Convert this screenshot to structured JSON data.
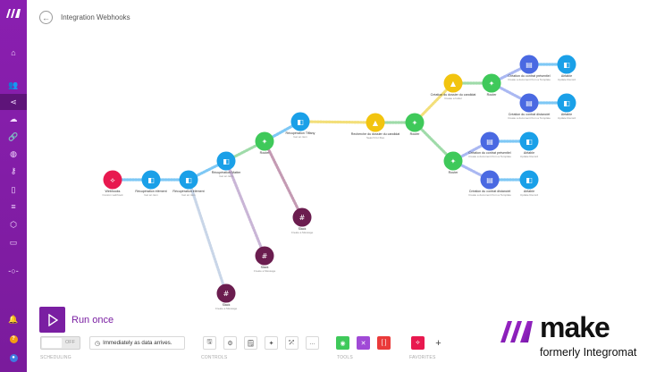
{
  "sidebar": {
    "logo": "make-logo",
    "items": [
      {
        "icon": "home-icon",
        "glyph": "⌂"
      },
      {
        "icon": "team-icon",
        "glyph": "👥"
      },
      {
        "icon": "share-scenarios-icon",
        "glyph": "⋖"
      },
      {
        "icon": "templates-icon",
        "glyph": "☁"
      },
      {
        "icon": "connections-icon",
        "glyph": "🔗"
      },
      {
        "icon": "webhooks-icon",
        "glyph": "◍"
      },
      {
        "icon": "keys-icon",
        "glyph": "⚷"
      },
      {
        "icon": "devices-icon",
        "glyph": "▯"
      },
      {
        "icon": "datastores-icon",
        "glyph": "≡"
      },
      {
        "icon": "datastructures-icon",
        "glyph": "⬡"
      },
      {
        "icon": "docs-icon",
        "glyph": "▭"
      },
      {
        "icon": "flow-icon",
        "glyph": "-○-"
      },
      {
        "icon": "notifications-icon",
        "glyph": "🔔"
      },
      {
        "icon": "help-icon",
        "glyph": "?"
      },
      {
        "icon": "avatar-icon",
        "glyph": "●"
      }
    ]
  },
  "header": {
    "title": "Integration Webhooks"
  },
  "canvas": {
    "nodes": [
      {
        "id": "webhooks",
        "label": "Webhooks",
        "sub": "Custom webhook",
        "color": "#e8194f",
        "icon": "webhook-icon"
      },
      {
        "id": "ax1",
        "label": "Récupération élément",
        "sub": "Get an item",
        "color": "#1aa0e8",
        "icon": "airtable-icon"
      },
      {
        "id": "ax2",
        "label": "Récupération élément",
        "sub": "Get an item",
        "color": "#1aa0e8",
        "icon": "airtable-icon"
      },
      {
        "id": "ax3",
        "label": "Récupération Matter",
        "sub": "Get an item",
        "color": "#1aa0e8",
        "icon": "airtable-icon"
      },
      {
        "id": "router1",
        "label": "Router",
        "sub": "",
        "color": "#3fc95a",
        "icon": "router-icon"
      },
      {
        "id": "ax4",
        "label": "Récupération Tiffany",
        "sub": "Get an item",
        "color": "#1aa0e8",
        "icon": "airtable-icon"
      },
      {
        "id": "gdrive1",
        "label": "Recherche du dossier du candidat",
        "sub": "Search for files",
        "color": "#f2c40f",
        "icon": "drive-icon"
      },
      {
        "id": "router2",
        "label": "Router",
        "sub": "",
        "color": "#3fc95a",
        "icon": "router-icon"
      },
      {
        "id": "gdrive2",
        "label": "Création du dossier du candidat",
        "sub": "Create a folder",
        "color": "#f2c40f",
        "icon": "drive-icon"
      },
      {
        "id": "router3",
        "label": "Router",
        "sub": "",
        "color": "#3fc95a",
        "icon": "router-icon"
      },
      {
        "id": "router4",
        "label": "Router",
        "sub": "",
        "color": "#3fc95a",
        "icon": "router-icon"
      },
      {
        "id": "doc1",
        "label": "Création du contrat présentiel",
        "sub": "Create a document from a Template",
        "color": "#4a69e2",
        "icon": "docs-icon"
      },
      {
        "id": "doc2",
        "label": "Création du contrat distanciel",
        "sub": "Create a document from a Template",
        "color": "#4a69e2",
        "icon": "docs-icon"
      },
      {
        "id": "doc3",
        "label": "Création du contrat présentiel",
        "sub": "Create a document from a Template",
        "color": "#4a69e2",
        "icon": "docs-icon"
      },
      {
        "id": "doc4",
        "label": "Création du contrat distanciel",
        "sub": "Create a document from a Template",
        "color": "#4a69e2",
        "icon": "docs-icon"
      },
      {
        "id": "ax5",
        "label": "Airtable",
        "sub": "Update Record",
        "color": "#1aa0e8",
        "icon": "airtable-icon"
      },
      {
        "id": "ax6",
        "label": "Airtable",
        "sub": "Update Record",
        "color": "#1aa0e8",
        "icon": "airtable-icon"
      },
      {
        "id": "ax7",
        "label": "Airtable",
        "sub": "Update Record",
        "color": "#1aa0e8",
        "icon": "airtable-icon"
      },
      {
        "id": "ax8",
        "label": "Airtable",
        "sub": "Update Record",
        "color": "#1aa0e8",
        "icon": "airtable-icon"
      },
      {
        "id": "slack1",
        "label": "Slack",
        "sub": "Create a Message",
        "color": "#6b1d4f",
        "icon": "slack-icon"
      },
      {
        "id": "slack2",
        "label": "Slack",
        "sub": "Create a Message",
        "color": "#6b1d4f",
        "icon": "slack-icon"
      },
      {
        "id": "slack3",
        "label": "Slack",
        "sub": "Create a Message",
        "color": "#6b1d4f",
        "icon": "slack-icon"
      }
    ]
  },
  "controls": {
    "run_once": "Run once",
    "toggle_state": "OFF",
    "schedule_text": "Immediately as data arrives.",
    "scheduling_label": "SCHEDULING",
    "controls_label": "CONTROLS",
    "tools_label": "TOOLS",
    "favorites_label": "FAVORITES",
    "control_buttons": [
      {
        "icon": "save-icon",
        "glyph": "🖫"
      },
      {
        "icon": "settings-icon",
        "glyph": "⚙"
      },
      {
        "icon": "notes-icon",
        "glyph": "🗒"
      },
      {
        "icon": "auto-align-icon",
        "glyph": "✦"
      },
      {
        "icon": "explain-flow-icon",
        "glyph": "⤱"
      },
      {
        "icon": "more-icon",
        "glyph": "…"
      }
    ],
    "tool_buttons": [
      {
        "icon": "flow-control-icon",
        "color": "#3fc95a",
        "glyph": "◉"
      },
      {
        "icon": "tools-icon",
        "color": "#a04ad6",
        "glyph": "✕"
      },
      {
        "icon": "text-parser-icon",
        "color": "#ea3a3a",
        "glyph": "[ ]"
      }
    ],
    "favorite_buttons": [
      {
        "icon": "webhook-favorite-icon",
        "color": "#e8194f",
        "glyph": "⟡"
      },
      {
        "icon": "add-favorite-icon",
        "color": "#ffffff",
        "glyph": "+"
      }
    ]
  },
  "brand": {
    "word": "make",
    "sub": "formerly Integromat",
    "accent": "#7a1fa2"
  }
}
